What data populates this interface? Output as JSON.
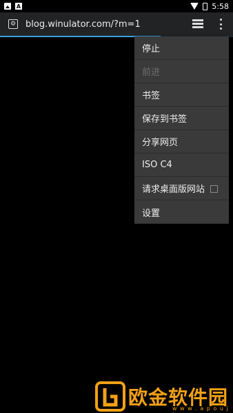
{
  "statusbar": {
    "time": "5:58",
    "left_icons": [
      "image-notification-icon",
      "a-notification-icon"
    ],
    "right_icons": [
      "wifi-icon",
      "battery-icon"
    ]
  },
  "urlbar": {
    "site_icon": "site-shield-icon",
    "url": "blog.winulator.com/?m=1",
    "tabs_icon": "tabs-stack-icon",
    "menu_icon": "overflow-menu-icon"
  },
  "progress": {
    "fraction": 0.69,
    "color": "#3ba3e0"
  },
  "menu": {
    "items": [
      {
        "label": "停止",
        "enabled": true
      },
      {
        "label": "前进",
        "enabled": false
      },
      {
        "label": "书签",
        "enabled": true
      },
      {
        "label": "保存到书签",
        "enabled": true
      },
      {
        "label": "分享网页",
        "enabled": true
      },
      {
        "label": "ISO C4",
        "enabled": true
      },
      {
        "label": "请求桌面版网站",
        "enabled": true,
        "checked": false
      },
      {
        "label": "设置",
        "enabled": true
      }
    ]
  },
  "watermark": {
    "text": "欧金软件园",
    "url": "w w w . a p o u j i n . c o m",
    "color": "#f2a115"
  }
}
